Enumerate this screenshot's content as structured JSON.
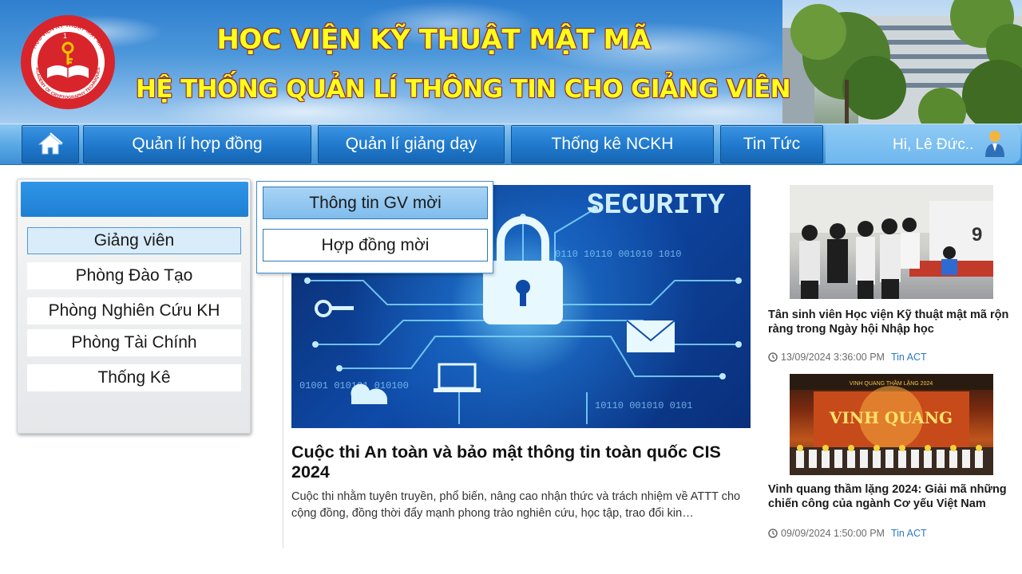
{
  "header": {
    "title_line1": "HỌC VIỆN KỸ THUẬT MẬT MÃ",
    "title_line2": "HỆ THỐNG QUẢN LÍ THÔNG TIN CHO GIẢNG VIÊN",
    "logo_icon": "academy-logo-icon",
    "logo_text_top": "HỌC VIỆN KỸ THUẬT MẬT MÃ",
    "logo_text_bottom": "ACADEMY OF CRYPTOGRAPHY TECHNIQUES",
    "logo_number": "1"
  },
  "nav": {
    "home_icon": "home-icon",
    "items": [
      {
        "label": "Quản lí hợp đồng"
      },
      {
        "label": "Quản lí giảng dạy"
      },
      {
        "label": "Thống kê NCKH"
      },
      {
        "label": "Tin Tức"
      }
    ],
    "user_greeting": "Hi, Lê Đức..",
    "user_icon": "user-avatar-icon"
  },
  "sidebar": {
    "items": [
      {
        "label": "Giảng viên",
        "active": true
      },
      {
        "label": "Phòng Đào Tạo"
      },
      {
        "label": "Phòng Nghiên Cứu KH"
      },
      {
        "label": "Phòng Tài Chính"
      },
      {
        "label": "Thống Kê"
      }
    ]
  },
  "submenu": {
    "items": [
      {
        "label": "Thông tin GV mời",
        "highlighted": true
      },
      {
        "label": "Hợp đồng mời"
      }
    ]
  },
  "main_article": {
    "image_text": "SECURITY",
    "title": "Cuộc thi An toàn và bảo mật thông tin toàn quốc CIS 2024",
    "description": "Cuộc thi nhằm tuyên truyền, phổ biến, nâng cao nhận thức và trách nhiệm về ATTT cho cộng đồng, đồng thời đẩy mạnh phong trào nghiên cứu, học tập, trao đổi kin…"
  },
  "news": [
    {
      "title": "Tân sinh viên Học viện Kỹ thuật mật mã rộn ràng trong Ngày hội Nhập học",
      "date": "13/09/2024 3:36:00 PM",
      "tag": "Tin ACT"
    },
    {
      "title": "Vinh quang thầm lặng 2024: Giải mã những chiến công của ngành Cơ yếu Việt Nam",
      "date": "09/09/2024 1:50:00 PM",
      "tag": "Tin ACT",
      "image_text_top": "VINH QUANG THẦM LẶNG 2024",
      "image_text_main": "VINH QUANG"
    }
  ],
  "colors": {
    "nav_button": "#1f78cc",
    "title_yellow": "#ffff1a",
    "link_blue": "#2d78c8"
  }
}
